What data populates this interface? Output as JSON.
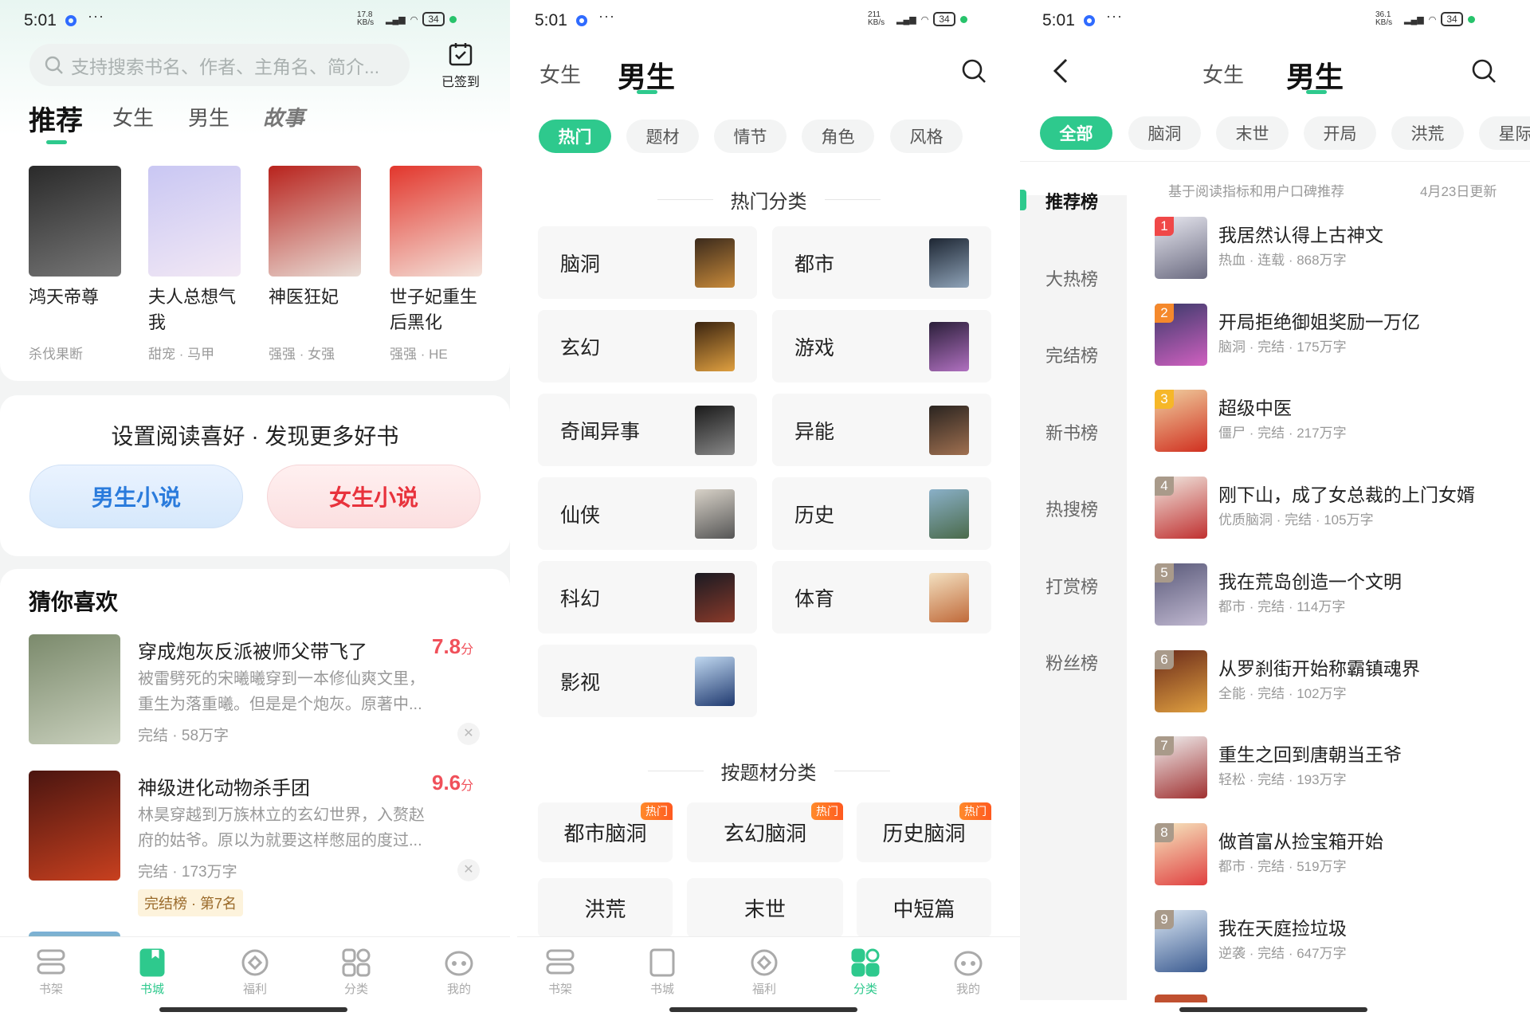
{
  "status_bars": [
    {
      "time": "5:01",
      "speed": "17.8 KB/s",
      "network": "HD",
      "battery": "34"
    },
    {
      "time": "5:01",
      "speed": "211 KB/s",
      "network": "HD",
      "battery": "34"
    },
    {
      "time": "5:01",
      "speed": "36.1 KB/s",
      "network": "HD",
      "battery": "34"
    }
  ],
  "accent_color": "#2ec98d",
  "store": {
    "search_placeholder": "支持搜索书名、作者、主角名、简介...",
    "checkin_label": "已签到",
    "tabs": [
      {
        "label": "推荐",
        "active": true
      },
      {
        "label": "女生"
      },
      {
        "label": "男生"
      },
      {
        "label": "故事"
      }
    ],
    "featured": [
      {
        "title": "鸿天帝尊",
        "tags": "杀伐果断",
        "colors": [
          "#2a2a2a",
          "#777"
        ]
      },
      {
        "title": "夫人总想气我",
        "tags": "甜宠 · 马甲",
        "colors": [
          "#c9c7f3",
          "#f2e8f4"
        ]
      },
      {
        "title": "神医狂妃",
        "tags": "强强 · 女强",
        "colors": [
          "#b8231d",
          "#e9ddd6"
        ]
      },
      {
        "title": "世子妃重生后黑化",
        "tags": "强强 · HE",
        "colors": [
          "#e2362c",
          "#f4e3db"
        ]
      }
    ],
    "preference": {
      "heading": "设置阅读喜好 · 发现更多好书",
      "male_button": "男生小说",
      "female_button": "女生小说"
    },
    "recommend": {
      "heading": "猜你喜欢",
      "items": [
        {
          "title": "穿成炮灰反派被师父带飞了",
          "score": "7.8",
          "score_unit": "分",
          "desc1": "被雷劈死的宋曦曦穿到一本修仙爽文里，",
          "desc2": "重生为落重曦。但是是个炮灰。原著中...",
          "meta": "完结 · 58万字",
          "colors": [
            "#7b8a6c",
            "#c9d0bd"
          ]
        },
        {
          "title": "神级进化动物杀手团",
          "score": "9.6",
          "score_unit": "分",
          "desc1": "林昊穿越到万族林立的玄幻世界，入赘赵",
          "desc2": "府的姑爷。原以为就要这样憋屈的度过...",
          "meta": "完结 · 173万字",
          "badge": "完结榜 · 第7名",
          "colors": [
            "#4a1510",
            "#c8401f"
          ]
        }
      ]
    }
  },
  "tabbar": [
    "书架",
    "书城",
    "福利",
    "分类",
    "我的"
  ],
  "category": {
    "gender_tabs": [
      "女生",
      "男生"
    ],
    "chips": [
      "热门",
      "题材",
      "情节",
      "角色",
      "风格"
    ],
    "hot_heading": "热门分类",
    "hot": [
      {
        "name": "脑洞",
        "colors": [
          "#3b2a1c",
          "#c88a3a"
        ]
      },
      {
        "name": "都市",
        "colors": [
          "#1d2633",
          "#8fa3b8"
        ]
      },
      {
        "name": "玄幻",
        "colors": [
          "#3b2410",
          "#e0a040"
        ]
      },
      {
        "name": "游戏",
        "colors": [
          "#2b1f3a",
          "#b070c0"
        ]
      },
      {
        "name": "奇闻异事",
        "colors": [
          "#1a1a1a",
          "#888"
        ]
      },
      {
        "name": "异能",
        "colors": [
          "#2a2420",
          "#a07050"
        ]
      },
      {
        "name": "仙侠",
        "colors": [
          "#d8d2c8",
          "#555"
        ]
      },
      {
        "name": "历史",
        "colors": [
          "#8ab0c8",
          "#4a6a4a"
        ]
      },
      {
        "name": "科幻",
        "colors": [
          "#1a1a22",
          "#8a3a2a"
        ]
      },
      {
        "name": "体育",
        "colors": [
          "#f3e0c0",
          "#c06a3a"
        ]
      },
      {
        "name": "影视",
        "colors": [
          "#c0d8f0",
          "#203a70"
        ]
      }
    ],
    "topic_heading": "按题材分类",
    "hot_label": "热门",
    "topics": [
      {
        "name": "都市脑洞",
        "hot": true
      },
      {
        "name": "玄幻脑洞",
        "hot": true
      },
      {
        "name": "历史脑洞",
        "hot": true
      },
      {
        "name": "洪荒"
      },
      {
        "name": "末世"
      },
      {
        "name": "中短篇"
      }
    ]
  },
  "ranking": {
    "gender_tabs": [
      "女生",
      "男生"
    ],
    "chips": [
      "全部",
      "脑洞",
      "末世",
      "开局",
      "洪荒",
      "星际"
    ],
    "sidebar": [
      "推荐榜",
      "大热榜",
      "完结榜",
      "新书榜",
      "热搜榜",
      "打赏榜",
      "粉丝榜"
    ],
    "subtitle": "基于阅读指标和用户口碑推荐",
    "updated": "4月23日更新",
    "rank_colors": [
      "#f04848",
      "#f5892c",
      "#f6b728",
      "#a99a8a"
    ],
    "items": [
      {
        "rank": "1",
        "title": "我居然认得上古神文",
        "meta": "热血 · 连载 · 868万字",
        "colors": [
          "#e8e8f0",
          "#6a6a80"
        ]
      },
      {
        "rank": "2",
        "title": "开局拒绝御姐奖励一万亿",
        "meta": "脑洞 · 完结 · 175万字",
        "colors": [
          "#3a3a6a",
          "#d060c0"
        ]
      },
      {
        "rank": "3",
        "title": "超级中医",
        "meta": "僵尸 · 完结 · 217万字",
        "colors": [
          "#f0d0a0",
          "#d03020"
        ]
      },
      {
        "rank": "4",
        "title": "刚下山，成了女总裁的上门女婿",
        "meta": "优质脑洞 · 完结 · 105万字",
        "colors": [
          "#f0e8e0",
          "#c03030"
        ]
      },
      {
        "rank": "5",
        "title": "我在荒岛创造一个文明",
        "meta": "都市 · 完结 · 114万字",
        "colors": [
          "#5a5a7a",
          "#c0b8d0"
        ]
      },
      {
        "rank": "6",
        "title": "从罗刹街开始称霸镇魂界",
        "meta": "全能 · 完结 · 102万字",
        "colors": [
          "#6a2a1a",
          "#e0a040"
        ]
      },
      {
        "rank": "7",
        "title": "重生之回到唐朝当王爷",
        "meta": "轻松 · 完结 · 193万字",
        "colors": [
          "#f0f0f0",
          "#a03030"
        ]
      },
      {
        "rank": "8",
        "title": "做首富从捡宝箱开始",
        "meta": "都市 · 完结 · 519万字",
        "colors": [
          "#f6e8c0",
          "#e04040"
        ]
      },
      {
        "rank": "9",
        "title": "我在天庭捡垃圾",
        "meta": "逆袭 · 完结 · 647万字",
        "colors": [
          "#dce8f4",
          "#3a5a90"
        ]
      }
    ]
  }
}
